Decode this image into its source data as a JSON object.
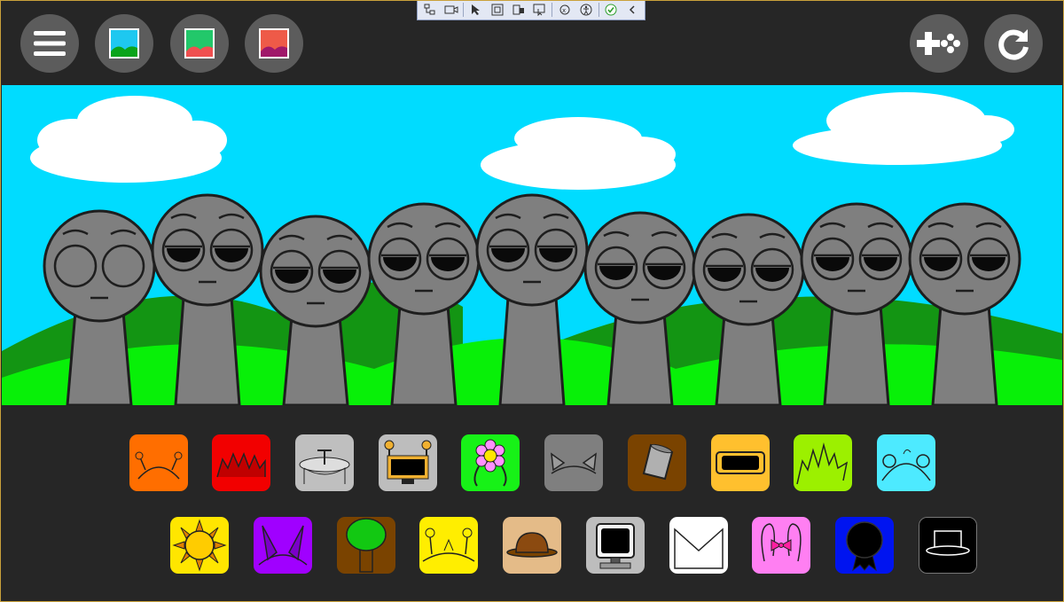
{
  "app": {
    "top_buttons": [
      {
        "name": "menu-button",
        "icon": "hamburger-icon"
      },
      {
        "name": "background-blue-button",
        "icon": "landscape-blue-icon",
        "colors": [
          "#1ec8f0",
          "#0aa41a"
        ]
      },
      {
        "name": "background-green-button",
        "icon": "landscape-green-icon",
        "colors": [
          "#22c86a",
          "#f05050"
        ]
      },
      {
        "name": "background-red-button",
        "icon": "landscape-red-icon",
        "colors": [
          "#ee5a48",
          "#a0186a"
        ]
      },
      {
        "name": "add-character-button",
        "icon": "gamepad-plus-icon"
      },
      {
        "name": "reset-button",
        "icon": "refresh-icon"
      }
    ],
    "debug_toolbar_icons": [
      "live-tree-icon",
      "record-icon",
      "select-element-icon",
      "display-layout-icon",
      "track-focus-icon",
      "preview-selection-icon",
      "binding-failures-icon",
      "accessibility-icon",
      "check-icon",
      "collapse-chevron-icon"
    ],
    "characters_count": 9,
    "colors": {
      "bg": "#262626",
      "sky": "#00dcff",
      "hill_dark": "#139513",
      "hill_light": "#08f008",
      "character": "#7f7f7f",
      "character_outline": "#1e1e1e",
      "button": "#5c5c5c"
    },
    "tray": {
      "row1": [
        {
          "name": "antenna-bugs",
          "icon": "antenna-icon",
          "color": "#ff6e00"
        },
        {
          "name": "spiky-crown",
          "icon": "spikes-icon",
          "color": "#f20000"
        },
        {
          "name": "propeller-hat",
          "icon": "propeller-icon",
          "color": "#bfbfbf"
        },
        {
          "name": "robot-screen",
          "icon": "robot-icon",
          "color": "#bdbdbd"
        },
        {
          "name": "flower",
          "icon": "flower-icon",
          "color": "#17f217"
        },
        {
          "name": "cat-ears",
          "icon": "cat-ears-icon",
          "color": "#7f7f7f"
        },
        {
          "name": "bucket",
          "icon": "bucket-icon",
          "color": "#7a4300"
        },
        {
          "name": "visor",
          "icon": "visor-icon",
          "color": "#ffc02e"
        },
        {
          "name": "grass-spikes",
          "icon": "grass-icon",
          "color": "#9cf000"
        },
        {
          "name": "bear-ears",
          "icon": "bear-ears-icon",
          "color": "#4deaff"
        }
      ],
      "row2": [
        {
          "name": "sun",
          "icon": "sun-icon",
          "color": "#ffe600"
        },
        {
          "name": "horns",
          "icon": "horns-icon",
          "color": "#a000ff"
        },
        {
          "name": "tree",
          "icon": "tree-icon",
          "color": "#7a4300"
        },
        {
          "name": "yellow-antennae",
          "icon": "yellow-antennae-icon",
          "color": "#ffee00"
        },
        {
          "name": "bowler-hat",
          "icon": "bowler-hat-icon",
          "color": "#e4bb88"
        },
        {
          "name": "computer",
          "icon": "computer-icon",
          "color": "#bdbdbd"
        },
        {
          "name": "white-envelope",
          "icon": "envelope-icon",
          "color": "#ffffff"
        },
        {
          "name": "bunny-ears-bow",
          "icon": "bunny-bow-icon",
          "color": "#ff7ff2"
        },
        {
          "name": "dark-medal",
          "icon": "medal-icon",
          "color": "#0014f0"
        },
        {
          "name": "top-hat",
          "icon": "top-hat-icon",
          "color": "#000000"
        }
      ]
    }
  }
}
